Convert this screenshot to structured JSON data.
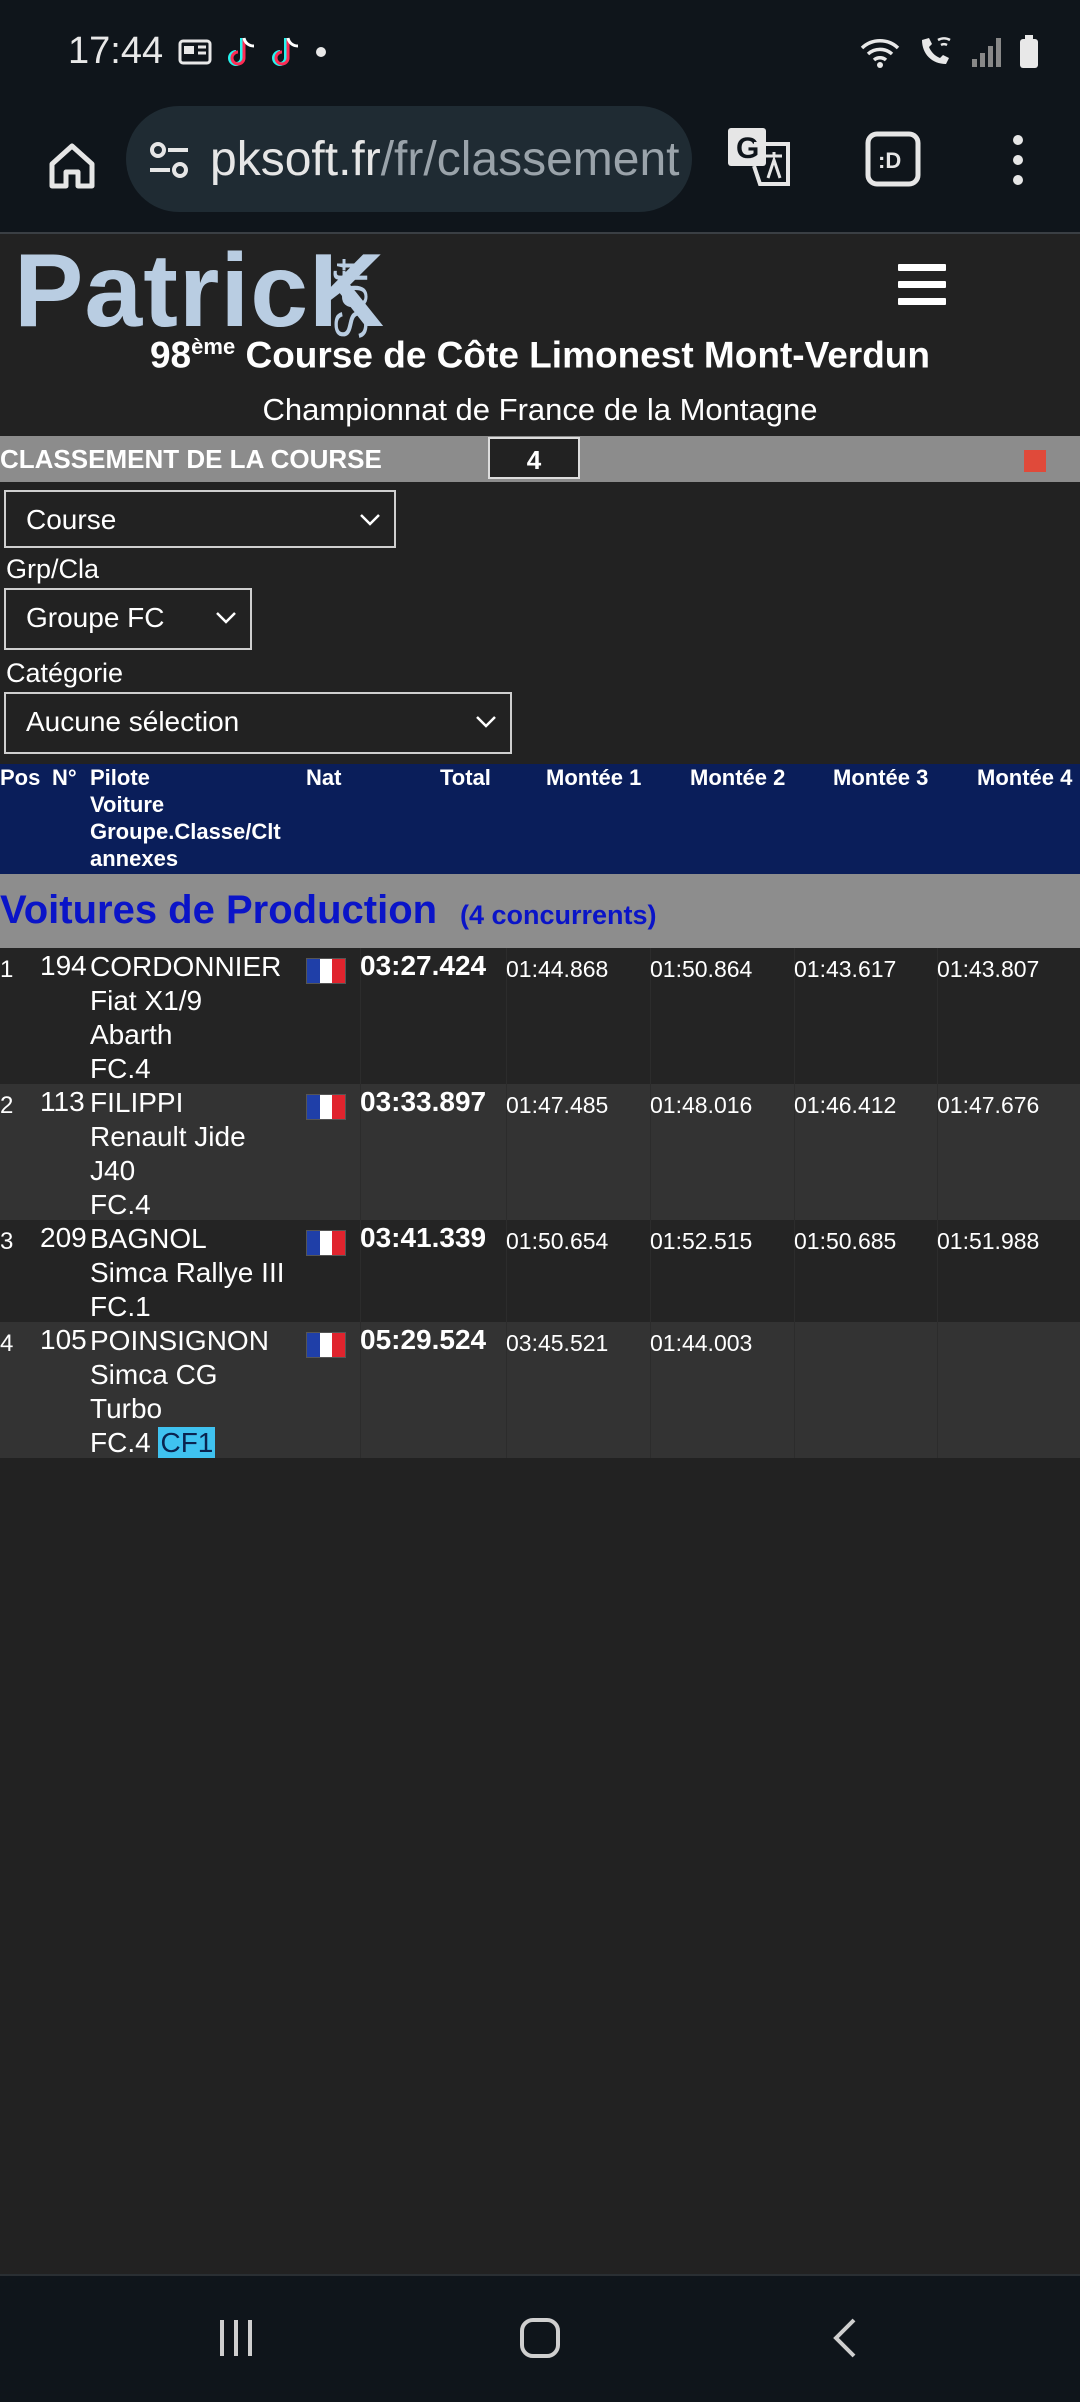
{
  "status_bar": {
    "time": "17:44",
    "left_icons": [
      "notification-card-icon",
      "tiktok-icon",
      "tiktok-icon",
      "dot-icon"
    ],
    "right_icons": [
      "wifi-icon",
      "wifi-calling-icon",
      "signal-icon",
      "battery-icon"
    ]
  },
  "browser": {
    "url_host": "pksoft.fr",
    "url_path": "/fr/classement"
  },
  "header": {
    "logo_main": "PatricK",
    "logo_soft": "Soft",
    "event_number": "98",
    "event_number_suffix": "ème",
    "event_title": " Course de Côte Limonest Mont-Verdun",
    "event_subtitle": "Championnat de France de la Montagne"
  },
  "classification_bar": {
    "label": "CLASSEMENT DE LA COURSE",
    "count": "4"
  },
  "filters": {
    "type_select": "Course",
    "group_label": "Grp/Cla",
    "group_select": "Groupe FC",
    "category_label": "Catégorie",
    "category_select": "Aucune sélection"
  },
  "table": {
    "headers": {
      "pos": "Pos",
      "num": "N°",
      "pilote_line1": "Pilote",
      "pilote_line2": "Voiture",
      "pilote_line3": "Groupe.Classe/Clt",
      "pilote_line4": "annexes",
      "nat": "Nat",
      "total": "Total",
      "m1": "Montée 1",
      "m2": "Montée 2",
      "m3": "Montée 3",
      "m4": "Montée 4"
    },
    "group_title": "Voitures de Production",
    "group_count": "(4 concurrents)",
    "rows": [
      {
        "pos": "1",
        "num": "194",
        "pilote": "CORDONNIER",
        "car1": "Fiat X1/9",
        "car2": "Abarth",
        "class": "FC.4",
        "total": "03:27.424",
        "m1": "01:44.868",
        "m2": "01:50.864",
        "m3": "01:43.617",
        "m4": "01:43.807"
      },
      {
        "pos": "2",
        "num": "113",
        "pilote": "FILIPPI",
        "car1": "Renault Jide",
        "car2": "J40",
        "class": "FC.4",
        "total": "03:33.897",
        "m1": "01:47.485",
        "m2": "01:48.016",
        "m3": "01:46.412",
        "m4": "01:47.676"
      },
      {
        "pos": "3",
        "num": "209",
        "pilote": "BAGNOL",
        "car1": "Simca Rallye III",
        "class": "FC.1",
        "total": "03:41.339",
        "m1": "01:50.654",
        "m2": "01:52.515",
        "m3": "01:50.685",
        "m4": "01:51.988"
      },
      {
        "pos": "4",
        "num": "105",
        "pilote": "POINSIGNON",
        "car1": "Simca CG",
        "car2": "Turbo",
        "class": "FC.4",
        "tag": "CF1",
        "total": "05:29.524",
        "m1": "03:45.521",
        "m2": "01:44.003"
      }
    ]
  },
  "colors": {
    "header_bg": "#0a1e5a",
    "group_title": "#0a14c8",
    "tag_bg": "#3fc2f0"
  }
}
